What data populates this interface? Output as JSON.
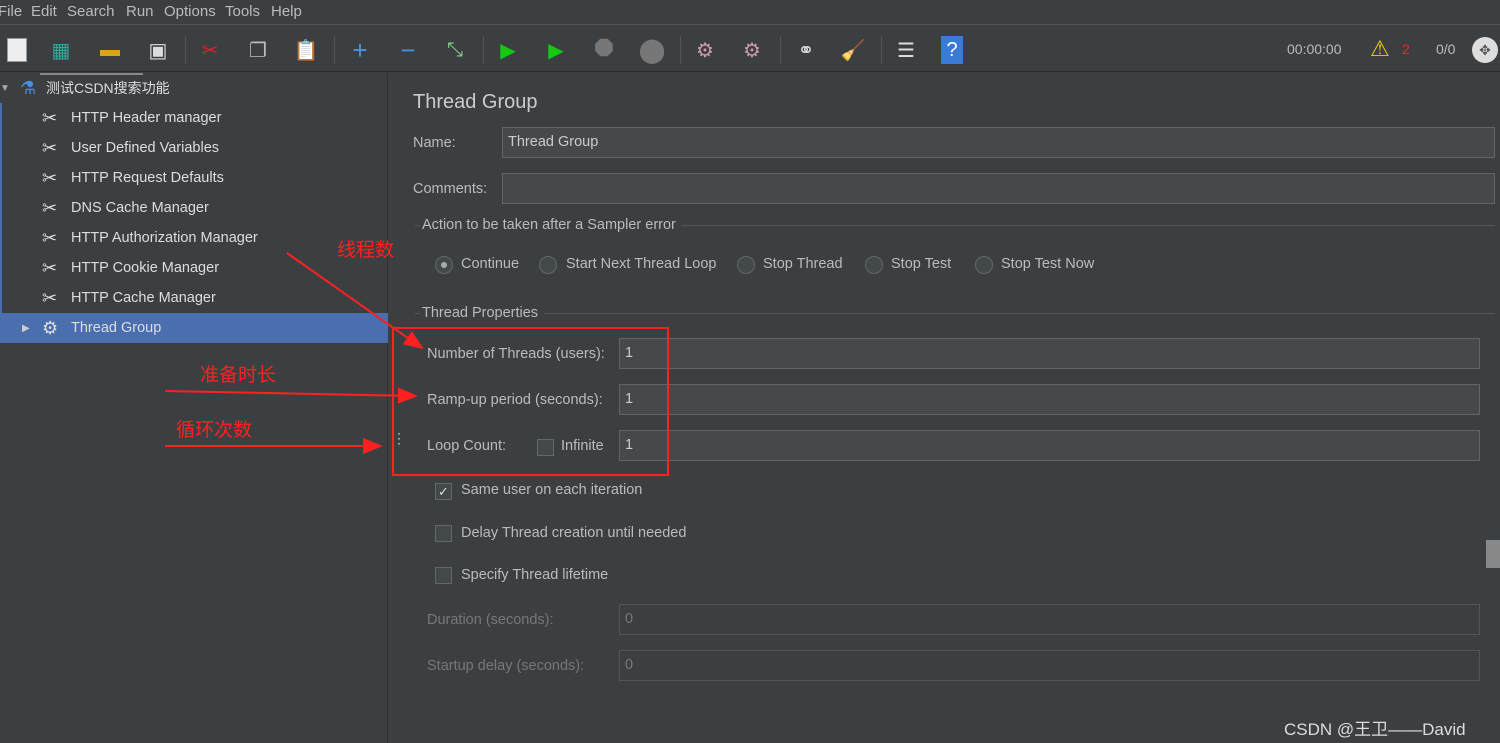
{
  "menu": [
    "File",
    "Edit",
    "Search",
    "Run",
    "Options",
    "Tools",
    "Help"
  ],
  "toolbar": {
    "icons": [
      "new-icon",
      "templates-icon",
      "open-icon",
      "save-icon",
      "cut-icon",
      "copy-icon",
      "paste-icon",
      "expand-icon",
      "collapse-icon",
      "toggle-icon",
      "start-icon",
      "start-no-pauses-icon",
      "stop-icon",
      "shutdown-icon",
      "clear-icon",
      "clear-all-icon",
      "search-icon",
      "reset-search-icon",
      "function-helper-icon",
      "help-icon"
    ],
    "timer": "00:00:00",
    "warning_count": "2",
    "threads": "0/0"
  },
  "tree": {
    "root": "测试CSDN搜索功能",
    "items": [
      "HTTP Header manager",
      "User Defined Variables",
      "HTTP Request Defaults",
      "DNS Cache Manager",
      "HTTP Authorization Manager",
      "HTTP Cookie Manager",
      "HTTP Cache Manager",
      "Thread Group"
    ]
  },
  "panel": {
    "title": "Thread Group",
    "name_label": "Name:",
    "name_value": "Thread Group",
    "comments_label": "Comments:",
    "comments_value": "",
    "error_section": "Action to be taken after a Sampler error",
    "error_options": [
      "Continue",
      "Start Next Thread Loop",
      "Stop Thread",
      "Stop Test",
      "Stop Test Now"
    ],
    "error_selected": "Continue",
    "props_section": "Thread Properties",
    "threads_label": "Number of Threads (users):",
    "threads_value": "1",
    "rampup_label": "Ramp-up period (seconds):",
    "rampup_value": "1",
    "loop_label": "Loop Count:",
    "infinite_label": "Infinite",
    "infinite_checked": false,
    "loop_value": "1",
    "same_user_label": "Same user on each iteration",
    "same_user_checked": true,
    "delay_label": "Delay Thread creation until needed",
    "delay_checked": false,
    "lifetime_label": "Specify Thread lifetime",
    "lifetime_checked": false,
    "duration_label": "Duration (seconds):",
    "duration_value": "0",
    "startup_label": "Startup delay (seconds):",
    "startup_value": "0"
  },
  "annotations": {
    "threads": "线程数",
    "rampup": "准备时长",
    "loop": "循环次数",
    "color": "#ff2020"
  },
  "watermark": "CSDN @王卫——David"
}
